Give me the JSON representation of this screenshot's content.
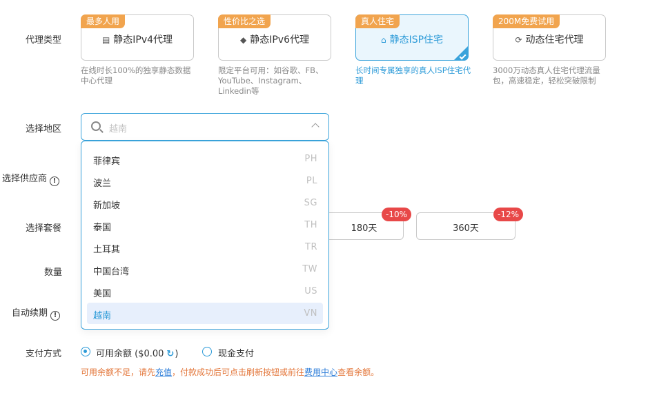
{
  "labels": {
    "proxy_type": "代理类型",
    "region": "选择地区",
    "provider": "选择供应商",
    "plan": "选择套餐",
    "quantity": "数量",
    "auto_renew": "自动续期",
    "payment": "支付方式"
  },
  "proxy_cards": [
    {
      "tag": "最多人用",
      "title": "静态IPv4代理",
      "icon": "server-icon",
      "desc": "在线时长100%的独享静态数据中心代理",
      "selected": false
    },
    {
      "tag": "性价比之选",
      "title": "静态IPv6代理",
      "icon": "layers-icon",
      "desc": "限定平台可用：如谷歌、FB、YouTube、Instagram、Linkedin等",
      "selected": false
    },
    {
      "tag": "真人住宅",
      "title": "静态ISP住宅",
      "icon": "home-icon",
      "desc": "长时间专属独享的真人ISP住宅代理",
      "selected": true
    },
    {
      "tag": "200M免费试用",
      "title": "动态住宅代理",
      "icon": "loading-icon",
      "desc": "3000万动态真人住宅代理流量包，高速稳定，轻松突破限制",
      "selected": false
    }
  ],
  "region_select": {
    "placeholder": "越南",
    "options": [
      {
        "name": "菲律宾",
        "code": "PH"
      },
      {
        "name": "波兰",
        "code": "PL"
      },
      {
        "name": "新加坡",
        "code": "SG"
      },
      {
        "name": "泰国",
        "code": "TH"
      },
      {
        "name": "土耳其",
        "code": "TR"
      },
      {
        "name": "中国台湾",
        "code": "TW"
      },
      {
        "name": "美国",
        "code": "US"
      },
      {
        "name": "越南",
        "code": "VN"
      }
    ],
    "active_index": 7
  },
  "plans": [
    {
      "label": "180天",
      "discount": "-10%"
    },
    {
      "label": "360天",
      "discount": "-12%"
    }
  ],
  "payment": {
    "balance_label": "可用余额 ($0.00",
    "balance_close": ")",
    "cash_label": "现金支付",
    "selected": "balance"
  },
  "warning": {
    "part1": "可用余额不足，请先",
    "link1": "充值",
    "part2": "，付款成功后可点击刷新按钮或前往",
    "link2": "费用中心",
    "part3": "查看余额。"
  },
  "colors": {
    "accent": "#2d9bd8",
    "tag": "#f1a44e",
    "discount": "#e84848",
    "warning": "#e3763a"
  }
}
